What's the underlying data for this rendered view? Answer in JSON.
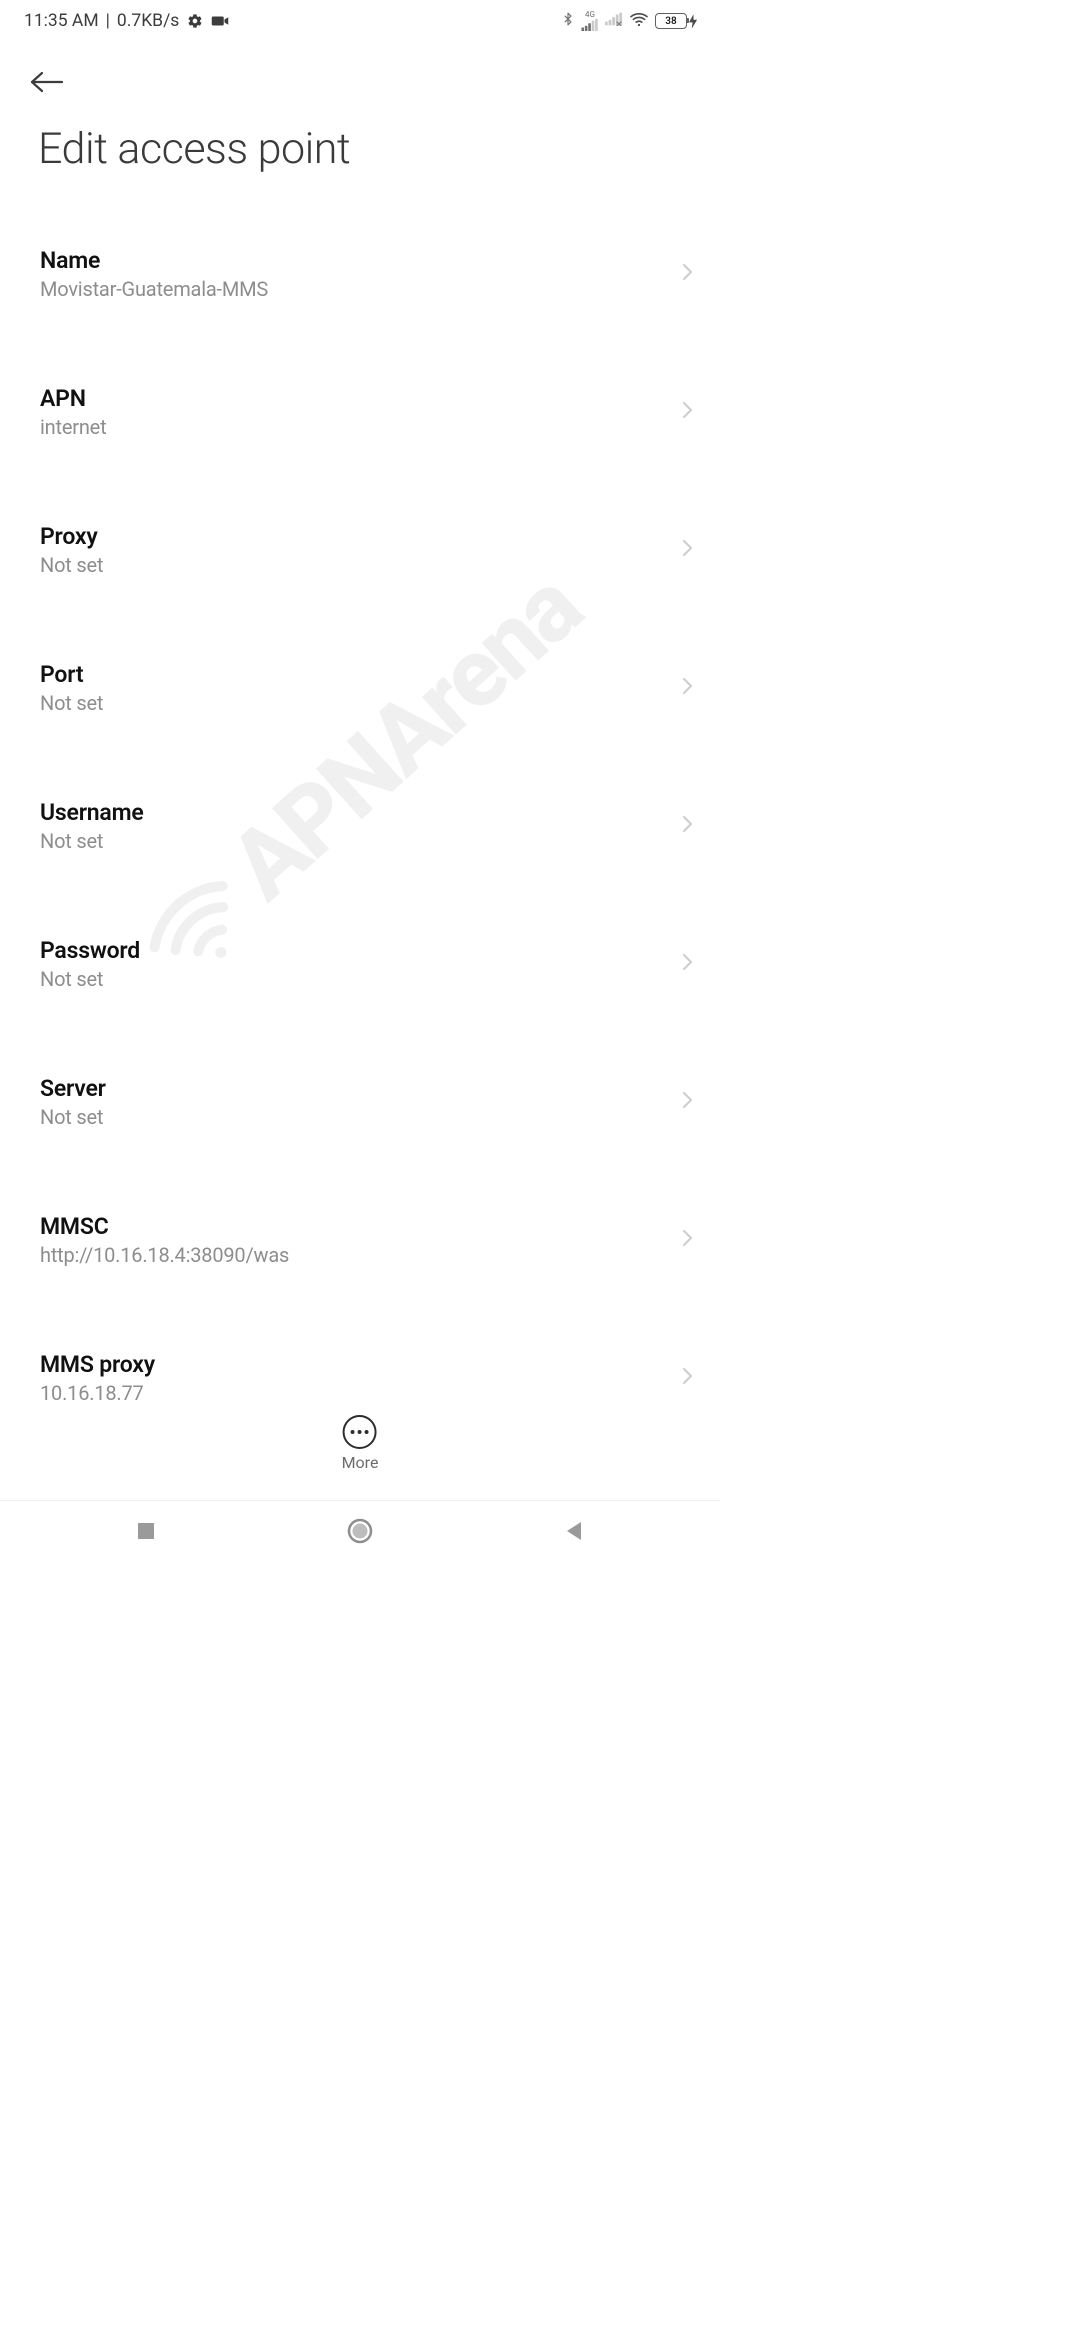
{
  "status": {
    "time": "11:35 AM",
    "separator": "|",
    "data_rate": "0.7KB/s",
    "network_indicator": "4G",
    "battery_percent": "38"
  },
  "header": {
    "title": "Edit access point"
  },
  "settings": [
    {
      "key": "name",
      "label": "Name",
      "value": "Movistar-Guatemala-MMS"
    },
    {
      "key": "apn",
      "label": "APN",
      "value": "internet"
    },
    {
      "key": "proxy",
      "label": "Proxy",
      "value": "Not set"
    },
    {
      "key": "port",
      "label": "Port",
      "value": "Not set"
    },
    {
      "key": "username",
      "label": "Username",
      "value": "Not set"
    },
    {
      "key": "password",
      "label": "Password",
      "value": "Not set"
    },
    {
      "key": "server",
      "label": "Server",
      "value": "Not set"
    },
    {
      "key": "mmsc",
      "label": "MMSC",
      "value": "http://10.16.18.4:38090/was"
    },
    {
      "key": "mmsproxy",
      "label": "MMS proxy",
      "value": "10.16.18.77"
    }
  ],
  "more_button": {
    "label": "More"
  },
  "watermark": {
    "text": "APNArena"
  }
}
